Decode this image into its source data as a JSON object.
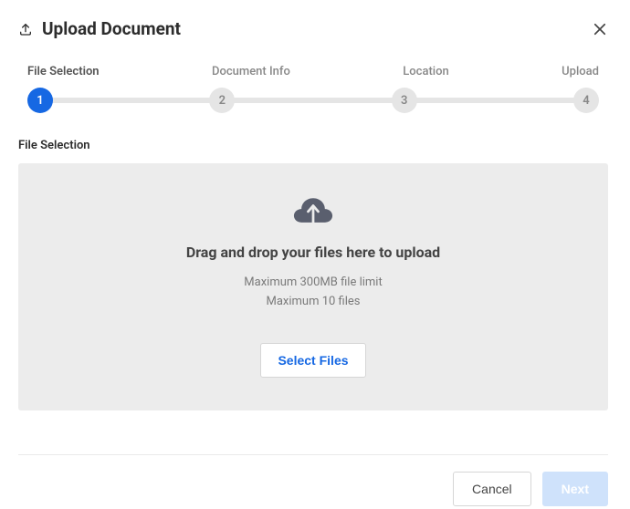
{
  "header": {
    "title": "Upload Document"
  },
  "stepper": {
    "steps": [
      {
        "label": "File Selection",
        "num": "1"
      },
      {
        "label": "Document Info",
        "num": "2"
      },
      {
        "label": "Location",
        "num": "3"
      },
      {
        "label": "Upload",
        "num": "4"
      }
    ],
    "activeIndex": 0
  },
  "section": {
    "label": "File Selection"
  },
  "dropzone": {
    "heading": "Drag and drop your files here to upload",
    "line1": "Maximum 300MB file limit",
    "line2": "Maximum 10 files",
    "selectButton": "Select Files"
  },
  "footer": {
    "cancel": "Cancel",
    "next": "Next"
  }
}
